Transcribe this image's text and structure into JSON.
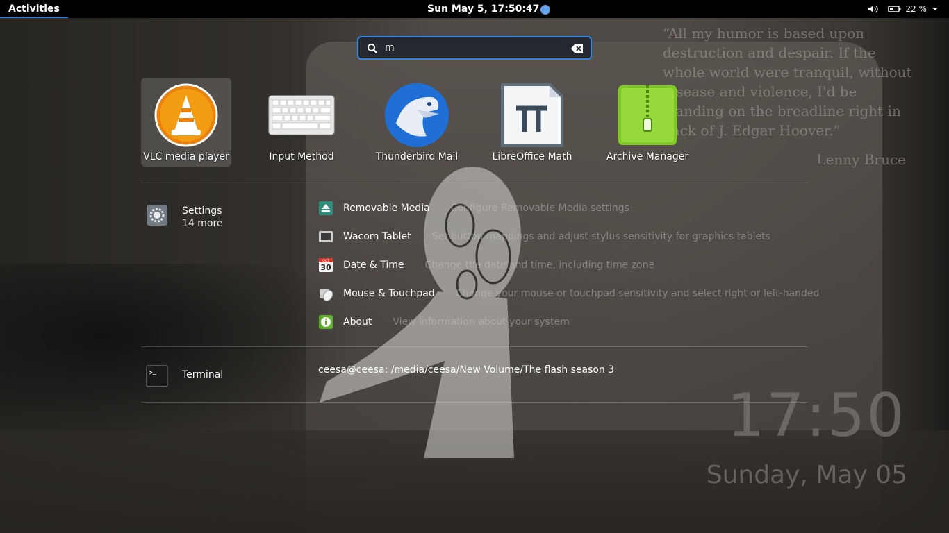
{
  "topbar": {
    "activities": "Activities",
    "clock": "Sun May  5, 17:50:47",
    "battery": "22 %"
  },
  "search": {
    "query": "m"
  },
  "apps": [
    {
      "label": "VLC media player",
      "icon": "vlc-icon"
    },
    {
      "label": "Input Method",
      "icon": "keyboard-icon"
    },
    {
      "label": "Thunderbird Mail",
      "icon": "thunderbird-icon"
    },
    {
      "label": "LibreOffice Math",
      "icon": "libreoffice-math-icon"
    },
    {
      "label": "Archive Manager",
      "icon": "archive-icon"
    }
  ],
  "settings": {
    "name": "Settings",
    "more": "14 more",
    "results": [
      {
        "name": "Removable Media",
        "desc": "Configure Removable Media settings",
        "icon": "removable-media-icon"
      },
      {
        "name": "Wacom Tablet",
        "desc": "Set button mappings and adjust stylus sensitivity for graphics tablets",
        "icon": "wacom-icon"
      },
      {
        "name": "Date & Time",
        "desc": "Change the date and time, including time zone",
        "icon": "calendar-icon",
        "cal_month": "OCT",
        "cal_day": "30"
      },
      {
        "name": "Mouse & Touchpad",
        "desc": "Change your mouse or touchpad sensitivity and select right or left-handed",
        "icon": "mouse-icon"
      },
      {
        "name": "About",
        "desc": "View information about your system",
        "icon": "info-icon"
      }
    ]
  },
  "terminal": {
    "name": "Terminal",
    "result": "ceesa@ceesa: /media/ceesa/New Volume/The flash season 3"
  },
  "quote": {
    "text": "“All my humor is based upon destruction and despair. If the whole world were tranquil, without disease and violence, I'd be standing on the breadline right in back of J. Edgar Hoover.”",
    "author": "Lenny Bruce"
  },
  "desktop_clock": {
    "time": "17:50",
    "date": "Sunday, May 05"
  },
  "colors": {
    "accent": "#3584e4",
    "topbar": "#000000"
  }
}
